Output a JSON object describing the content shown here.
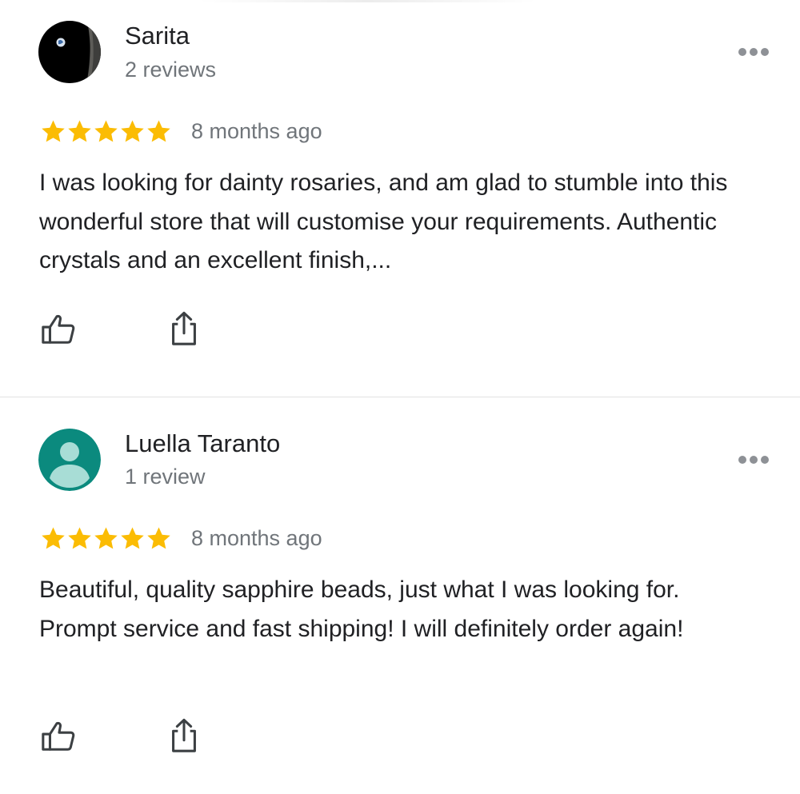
{
  "reviews": [
    {
      "author": "Sarita",
      "review_count": "2 reviews",
      "rating": 5,
      "max_rating": 5,
      "time": "8 months ago",
      "text": "I was looking for dainty rosaries, and am glad to stumble into this wonderful store that will customise your requirements. Authentic crystals and an excellent finish,...",
      "avatar_icon": "earth-photo-avatar"
    },
    {
      "author": "Luella Taranto",
      "review_count": "1 review",
      "rating": 5,
      "max_rating": 5,
      "time": "8 months ago",
      "text": "Beautiful, quality sapphire beads, just what I was looking for. Prompt service and fast shipping! I will definitely order again!",
      "avatar_icon": "default-person-avatar"
    }
  ],
  "icons": {
    "star": "star-icon",
    "like": "thumbs-up-icon",
    "share": "share-icon",
    "more": "more-options-icon"
  },
  "colors": {
    "star": "#fbbc04",
    "default_avatar_bg": "#0b8a7e",
    "default_avatar_figure": "#a8ddd6",
    "secondary_text": "#70757a",
    "primary_text": "#202124"
  }
}
